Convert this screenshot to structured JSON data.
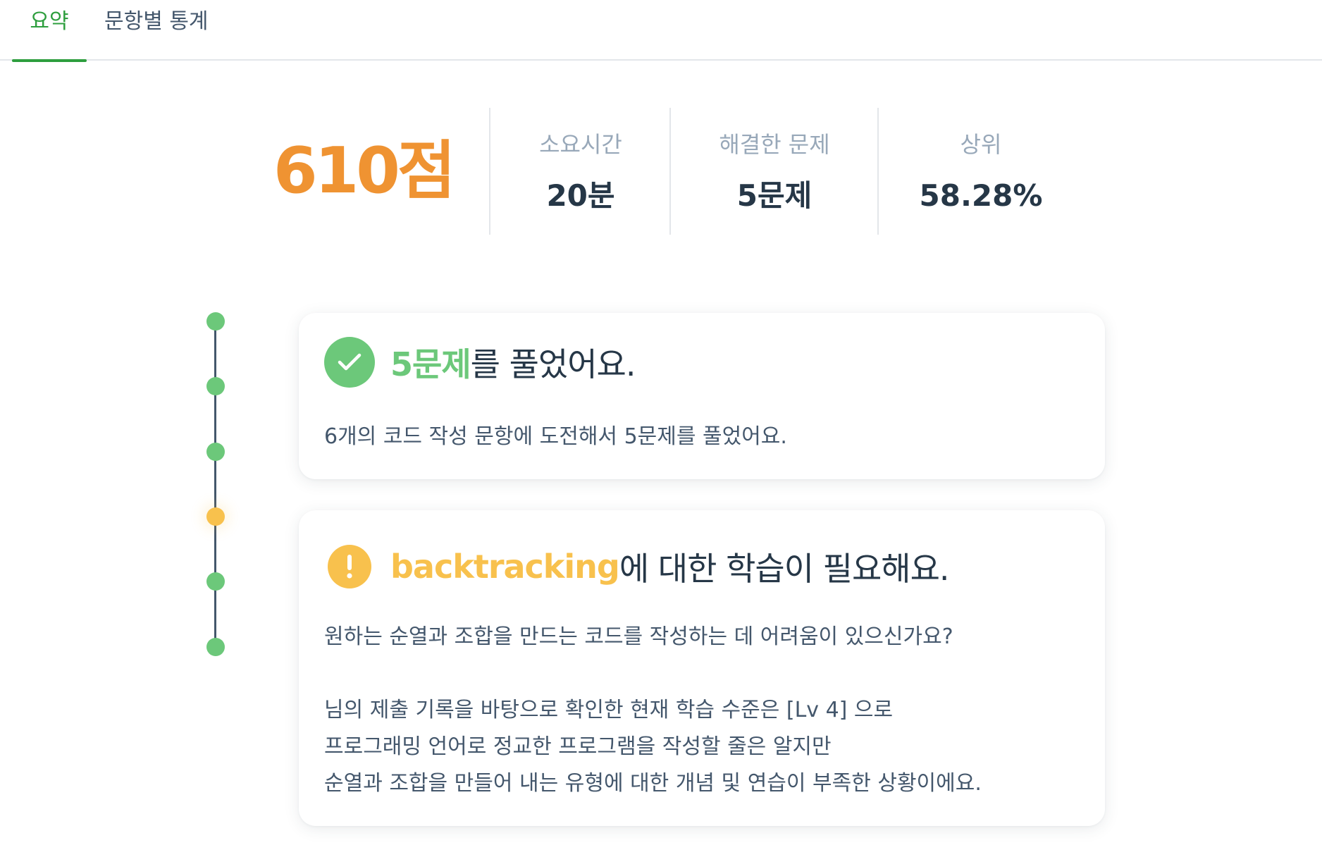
{
  "tabs": [
    {
      "label": "요약",
      "active": true
    },
    {
      "label": "문항별 통계",
      "active": false
    }
  ],
  "summary": {
    "score": "610점",
    "stats": [
      {
        "label": "소요시간",
        "value": "20분"
      },
      {
        "label": "해결한 문제",
        "value": "5문제"
      },
      {
        "label": "상위",
        "value": "58.28%"
      }
    ]
  },
  "timeline": {
    "dots": [
      "success",
      "success",
      "success",
      "warning",
      "success",
      "success"
    ]
  },
  "cards": [
    {
      "status": "success",
      "icon": "check-icon",
      "highlight": "5문제",
      "title_rest": "를 풀었어요.",
      "body": "6개의 코드 작성 문항에 도전해서 5문제를 풀었어요."
    },
    {
      "status": "warning",
      "icon": "exclamation-icon",
      "highlight": "backtracking",
      "title_rest": "에 대한 학습이 필요해요.",
      "body_lines": [
        "원하는 순열과 조합을 만드는 코드를 작성하는 데 어려움이 있으신가요?",
        "님의 제출 기록을 바탕으로 확인한 현재 학습 수준은 [Lv 4] 으로",
        "프로그래밍 언어로 정교한 프로그램을 작성할 줄은 알지만",
        "순열과 조합을 만들어 내는 유형에 대한 개념 및 연습이 부족한 상황이에요."
      ]
    }
  ],
  "colors": {
    "accent_green": "#2e9e3e",
    "success": "#6cc87a",
    "warning": "#f8c14d",
    "score": "#ef9332"
  }
}
